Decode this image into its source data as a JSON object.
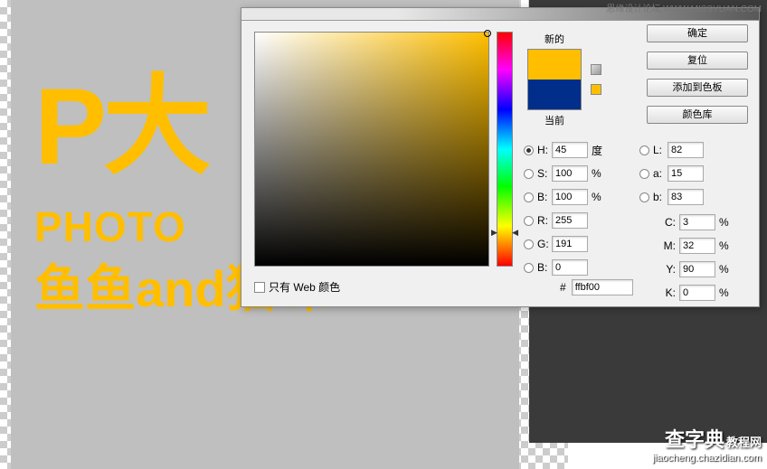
{
  "watermark": {
    "top_text": "思缘设计论坛   WWW.MISSYUAN.COM",
    "bottom_main": "查字典",
    "bottom_suffix": "教程网",
    "bottom_url": "jiaocheng.chazidian.com"
  },
  "canvas": {
    "line1": "P大",
    "line2": "PHOTO",
    "line3": "鱼鱼and猫咪"
  },
  "picker": {
    "labels": {
      "new": "新的",
      "current": "当前",
      "web_only": "只有 Web 颜色",
      "H": "H:",
      "S": "S:",
      "B": "B:",
      "R": "R:",
      "G": "G:",
      "Bc": "B:",
      "L": "L:",
      "a": "a:",
      "bl": "b:",
      "C": "C:",
      "M": "M:",
      "Y": "Y:",
      "K": "K:",
      "deg": "度",
      "pct": "%",
      "hash": "#"
    },
    "values": {
      "H": "45",
      "S": "100",
      "B": "100",
      "R": "255",
      "G": "191",
      "Bc": "0",
      "L": "82",
      "a": "15",
      "bl": "83",
      "C": "3",
      "M": "32",
      "Y": "90",
      "K": "0",
      "hex": "ffbf00"
    },
    "buttons": {
      "ok": "确定",
      "reset": "复位",
      "add": "添加到色板",
      "lib": "颜色库"
    }
  }
}
